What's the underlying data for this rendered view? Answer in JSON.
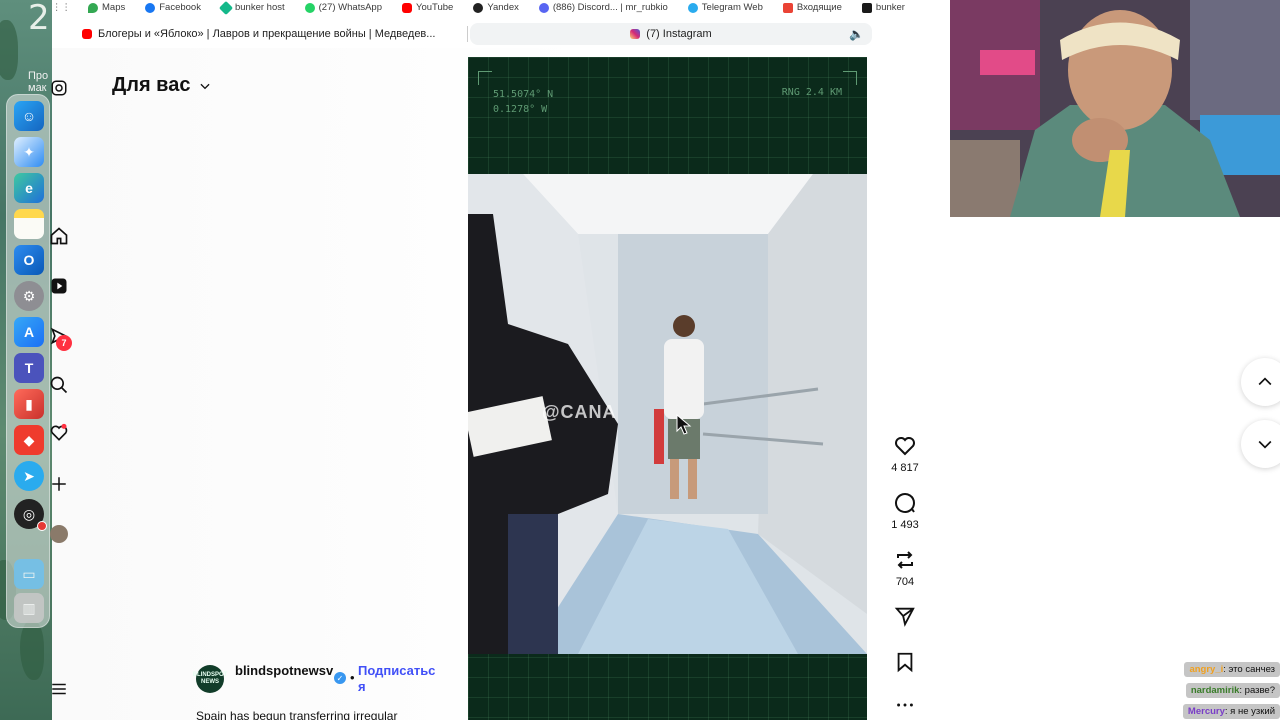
{
  "desktop": {
    "workspace_number": "2",
    "desktop_text": "Про мак"
  },
  "dock": {
    "apps": [
      "Finder",
      "Safari",
      "Edge",
      "Notes",
      "Outlook",
      "System Settings",
      "App Store",
      "Teams",
      "Parallels",
      "AnyDesk",
      "Telegram",
      "OBS",
      "Folder",
      "Trash"
    ]
  },
  "bookmarks": [
    {
      "label": "Maps",
      "color": "#34a853"
    },
    {
      "label": "Facebook",
      "color": "#1877f2"
    },
    {
      "label": "bunker host",
      "color": "#14b88a"
    },
    {
      "label": "(27) WhatsApp",
      "color": "#25d366"
    },
    {
      "label": "YouTube",
      "color": "#ff0000"
    },
    {
      "label": "Yandex",
      "color": "#222222"
    },
    {
      "label": "(886) Discord... | mr_rubkio",
      "color": "#5865f2"
    },
    {
      "label": "Telegram Web",
      "color": "#2aabee"
    },
    {
      "label": "Входящие",
      "color": "#ea4335"
    },
    {
      "label": "bunker",
      "color": "#1a1a1a"
    }
  ],
  "tabs": {
    "first": "Блогеры и «Яблоко» | Лавров и прекращение войны | Медведев...",
    "second": "(7) Instagram"
  },
  "instagram": {
    "feed_title": "Для вас",
    "notification_count": "7",
    "reel": {
      "coord_lat": "51.5074° N",
      "coord_lon": "0.1278° W",
      "range": "RNG 2.4 KM",
      "watermark": "@CANA",
      "likes": "4 817",
      "comments": "1 493",
      "reposts": "704",
      "username": "blindspotnewsv",
      "avatar_text": "BLINDSPOT NEWS",
      "follow_label": "Подписаться",
      "dot": "•",
      "caption": "Spain has begun transferring irregular"
    }
  },
  "chat": [
    {
      "user": "angry_i",
      "text": ": это санчез",
      "color": "#f0a020"
    },
    {
      "user": "nardamirik",
      "text": ": разве?",
      "color": "#3a7d2a"
    },
    {
      "user": "Mercury",
      "text": ": я не узкий",
      "color": "#7a3ec8"
    }
  ],
  "colors": {
    "instagram_blue": "#4150f7",
    "badge_red": "#ff3040",
    "reel_bg": "#0b2a1b",
    "hud_green": "#5f9a73"
  }
}
